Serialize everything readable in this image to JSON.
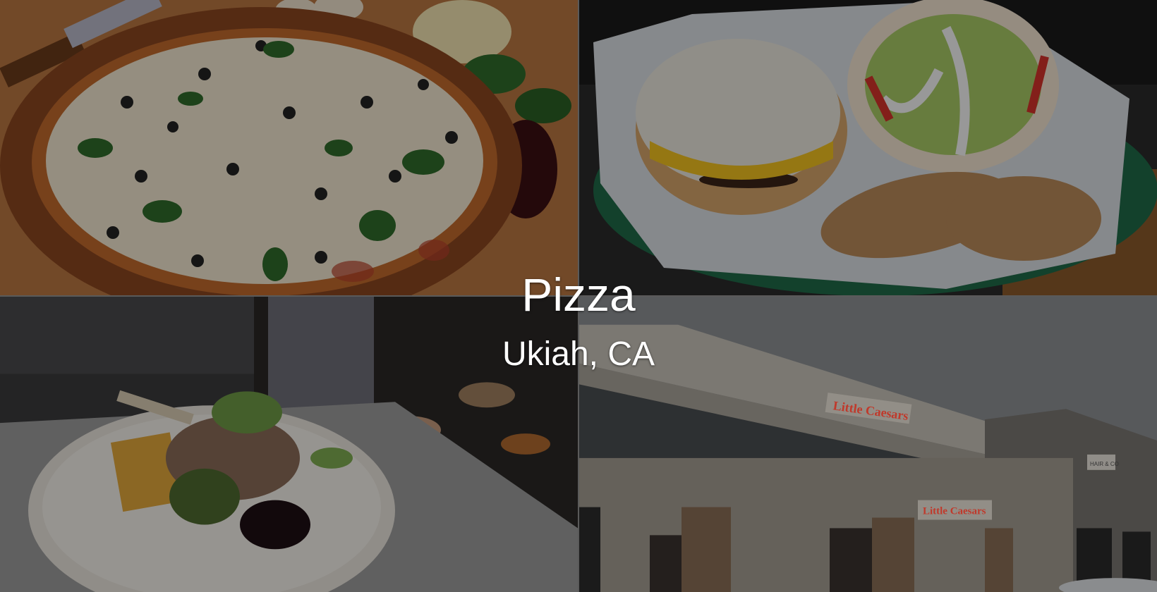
{
  "hero": {
    "title": "Pizza",
    "subtitle": "Ukiah, CA"
  },
  "tiles": [
    {
      "name": "pizza-photo",
      "alt": "Pizza with spinach and olives"
    },
    {
      "name": "burger-basket-photo",
      "alt": "Burger with chicken strips in basket"
    },
    {
      "name": "plated-dish-photo",
      "alt": "Plated lamb chop dish"
    },
    {
      "name": "storefront-photo",
      "alt": "Strip mall storefront"
    }
  ],
  "storefront": {
    "sign_main": "Little Caesars",
    "sign_lower": "Little Caesars",
    "sign_side": "HAIR & CO"
  },
  "colors": {
    "overlay": "#000000",
    "text": "#ffffff",
    "sign_red": "#c0392b"
  }
}
